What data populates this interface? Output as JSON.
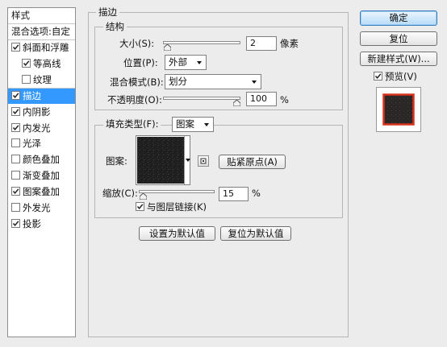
{
  "sidebar": {
    "header": "样式",
    "blending": "混合选项:自定",
    "items": [
      {
        "label": "斜面和浮雕",
        "checked": true
      },
      {
        "label": "等高线",
        "checked": true
      },
      {
        "label": "纹理",
        "checked": false
      },
      {
        "label": "描边",
        "checked": true,
        "selected": true
      },
      {
        "label": "内阴影",
        "checked": true
      },
      {
        "label": "内发光",
        "checked": true
      },
      {
        "label": "光泽",
        "checked": false
      },
      {
        "label": "颜色叠加",
        "checked": false
      },
      {
        "label": "渐变叠加",
        "checked": false
      },
      {
        "label": "图案叠加",
        "checked": true
      },
      {
        "label": "外发光",
        "checked": false
      },
      {
        "label": "投影",
        "checked": true
      }
    ]
  },
  "stroke": {
    "title": "描边",
    "structure_title": "结构",
    "size_label": "大小(S):",
    "size_value": "2",
    "size_unit": "像素",
    "size_level": 0.01,
    "position_label": "位置(P):",
    "position_value": "外部",
    "blend_label": "混合模式(B):",
    "blend_value": "划分",
    "opacity_label": "不透明度(O):",
    "opacity_value": "100",
    "opacity_unit": "%",
    "opacity_level": 1.0,
    "fill_type_label": "填充类型(F):",
    "fill_type_value": "图案",
    "pattern_label": "图案:",
    "snap_button": "贴紧原点(A)",
    "scale_label": "缩放(C):",
    "scale_value": "15",
    "scale_unit": "%",
    "scale_level": 0.015,
    "link_label": "与图层链接(K)",
    "link_checked": true,
    "make_default": "设置为默认值",
    "reset_default": "复位为默认值"
  },
  "actions": {
    "ok": "确定",
    "reset": "复位",
    "new_style": "新建样式(W)...",
    "preview": "预览(V)",
    "preview_checked": true
  },
  "colors": {
    "selection": "#3399ff",
    "primary_button": "#b8dcf7",
    "preview_stroke": "#d8321f"
  }
}
